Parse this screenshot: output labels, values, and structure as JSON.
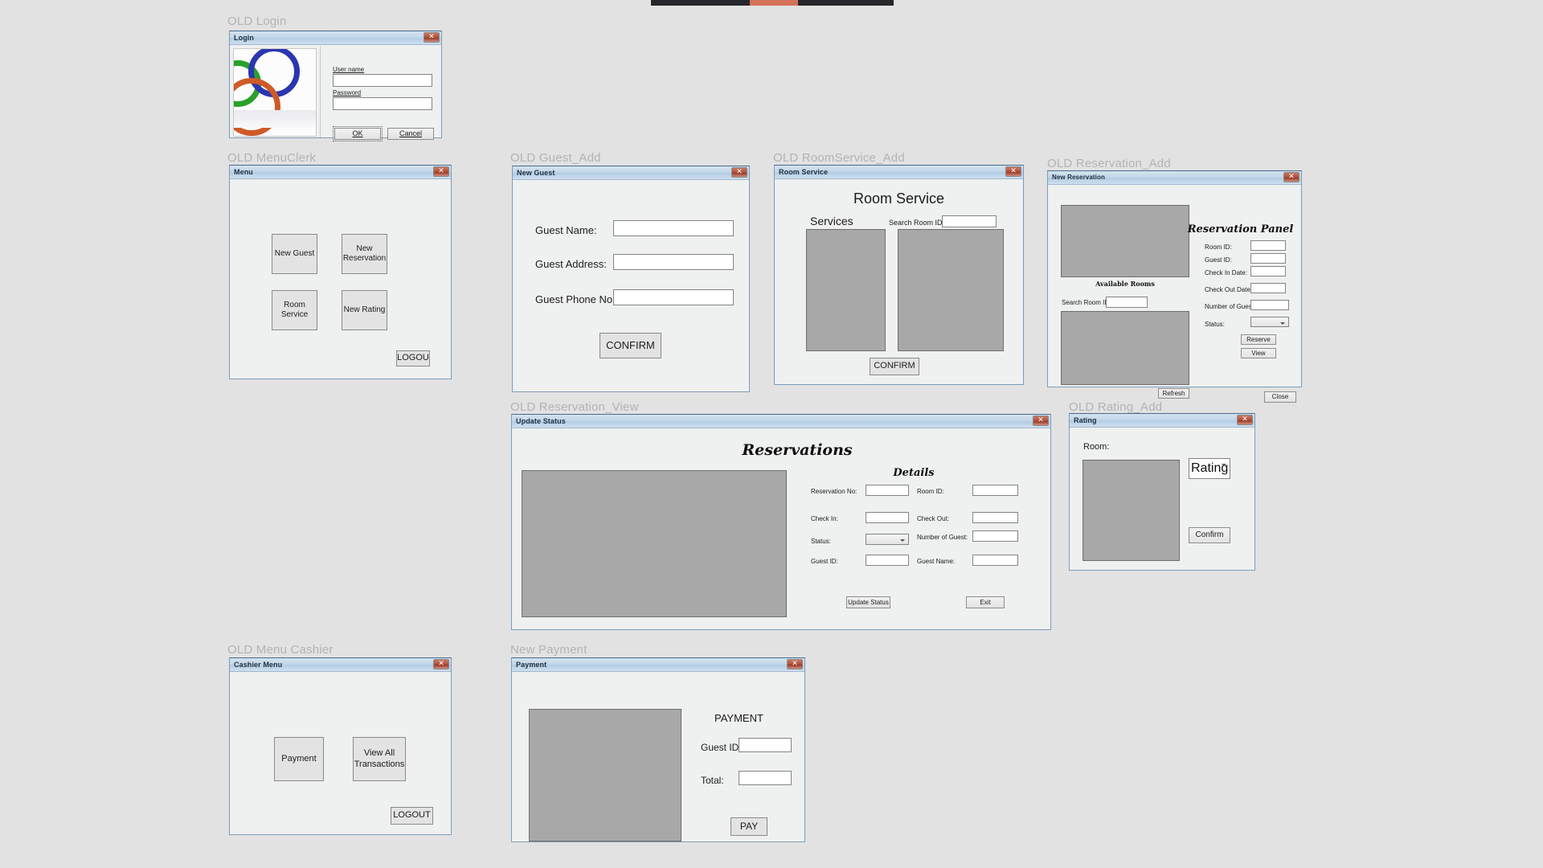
{
  "background_color": "#e2e2e2",
  "top_strip": {
    "color": "#26272a",
    "accent_color": "#d4725a"
  },
  "sections": [
    {
      "caption": "OLD Login"
    },
    {
      "caption": "OLD MenuClerk"
    },
    {
      "caption": "OLD Guest_Add"
    },
    {
      "caption": "OLD RoomService_Add"
    },
    {
      "caption": "OLD Reservation_Add"
    },
    {
      "caption": "OLD Reservation_View"
    },
    {
      "caption": "OLD Rating_Add"
    },
    {
      "caption": "OLD Menu Cashier"
    },
    {
      "caption": "New Payment"
    }
  ],
  "login": {
    "caption": "OLD Login",
    "title": "Login",
    "close": "✕",
    "username_label": "User name",
    "username_value": "",
    "password_label": "Password",
    "password_value": "",
    "ok_label": "OK",
    "cancel_label": "Cancel",
    "image_name": "interlocking-rings-image"
  },
  "menu_clerk": {
    "caption": "OLD MenuClerk",
    "title": "Menu",
    "close": "✕",
    "buttons": [
      {
        "label": "New Guest"
      },
      {
        "label": "New Reservation"
      },
      {
        "label": "Room Service"
      },
      {
        "label": "New Rating"
      }
    ],
    "logout_label": "LOGOU"
  },
  "guest_add": {
    "caption": "OLD Guest_Add",
    "title": "New Guest",
    "close": "✕",
    "fields": [
      {
        "label": "Guest Name:",
        "value": ""
      },
      {
        "label": "Guest Address:",
        "value": ""
      },
      {
        "label": "Guest Phone No:",
        "value": ""
      }
    ],
    "confirm_label": "CONFIRM"
  },
  "room_service_add": {
    "caption": "OLD RoomService_Add",
    "title": "Room Service",
    "close": "✕",
    "heading": "Room Service",
    "services_label": "Services",
    "search_label": "Search Room ID:",
    "search_value": "",
    "confirm_label": "CONFIRM",
    "services_grid_name": "services-list-grid",
    "rooms_grid_name": "rooms-list-grid"
  },
  "reservation_add": {
    "caption": "OLD Reservation_Add",
    "title": "New Reservation",
    "close": "✕",
    "panel_heading": "Reservation Panel",
    "available_rooms_label": "Available Rooms",
    "search_label": "Search Room ID:",
    "search_value": "",
    "fields": [
      {
        "label": "Room ID:",
        "value": ""
      },
      {
        "label": "Guest ID:",
        "value": ""
      },
      {
        "label": "Check In Date:",
        "value": ""
      },
      {
        "label": "Check Out Date:",
        "value": ""
      },
      {
        "label": "Number of Guests:",
        "value": ""
      }
    ],
    "status_label": "Status:",
    "status_value": "",
    "reserve_label": "Reserve",
    "view_label": "View",
    "refresh_label": "Refresh",
    "close_label": "Close"
  },
  "reservation_view": {
    "caption": "OLD Reservation_View",
    "title": "Update Status",
    "close": "✕",
    "heading": "Reservations",
    "details_heading": "Details",
    "fields_left": [
      {
        "label": "Reservation No:",
        "value": ""
      },
      {
        "label": "Check In:",
        "value": ""
      }
    ],
    "status_label": "Status:",
    "status_value": "",
    "guest_id_label": "Guest ID:",
    "guest_id_value": "",
    "fields_right": [
      {
        "label": "Room ID:",
        "value": ""
      },
      {
        "label": "Check Out:",
        "value": ""
      },
      {
        "label": "Number of Guest:",
        "value": ""
      },
      {
        "label": "Guest Name:",
        "value": ""
      }
    ],
    "update_status_label": "Update Status",
    "exit_label": "Exit"
  },
  "rating_add": {
    "caption": "OLD Rating_Add",
    "title": "Rating",
    "close": "✕",
    "room_label": "Room:",
    "rating_combo_value": "Rating",
    "confirm_label": "Confirm"
  },
  "menu_cashier": {
    "caption": "OLD Menu Cashier",
    "title": "Cashier Menu",
    "close": "✕",
    "buttons": [
      {
        "label": "Payment"
      },
      {
        "label": "View All Transactions"
      }
    ],
    "logout_label": "LOGOUT"
  },
  "payment": {
    "caption": "New Payment",
    "title": "Payment",
    "close": "✕",
    "heading": "PAYMENT",
    "fields": [
      {
        "label": "Guest ID:",
        "value": ""
      },
      {
        "label": "Total:",
        "value": ""
      }
    ],
    "pay_label": "PAY"
  }
}
